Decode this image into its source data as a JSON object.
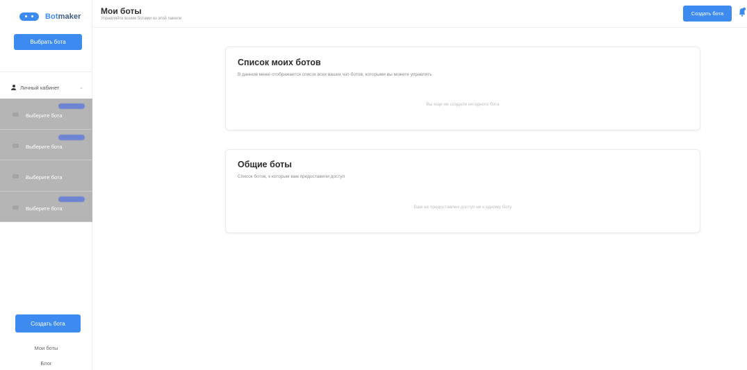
{
  "sidebar": {
    "logo_text": "Botmaker",
    "select_bot_label": "Выбрать бота",
    "cabinet_label": "Личный кабинет",
    "bot_items": [
      {
        "label": "Выберите бота"
      },
      {
        "label": "Выберите бота"
      },
      {
        "label": "Выберите бота"
      },
      {
        "label": "Выберите бота"
      }
    ],
    "create_bot_label": "Создать бота",
    "nav": {
      "my_bots": "Мои боты",
      "blog": "Блог"
    }
  },
  "header": {
    "title": "Мои боты",
    "subtitle": "Управляйте всеми ботами из этой панели",
    "create_bot_label": "Создать бота"
  },
  "main": {
    "my_bots_card": {
      "title": "Список моих ботов",
      "description": "В данном меню отображается список всех ваших чат-ботов, которыми вы можете управлять",
      "empty_text": "Вы еще не создали ни одного бота"
    },
    "shared_bots_card": {
      "title": "Общие боты",
      "description": "Список ботов, к которым вам предоставили доступ",
      "empty_text": "Вам не предоставлен доступ ни к одному боту"
    }
  },
  "colors": {
    "accent": "#3d8bf0",
    "bot_list_bg": "#b5b5b5"
  },
  "icons": {
    "logo": "bot-logo-icon",
    "cabinet": "user-icon",
    "cabinet_chevron": "chevron-down-icon",
    "bell": "bell-icon"
  }
}
